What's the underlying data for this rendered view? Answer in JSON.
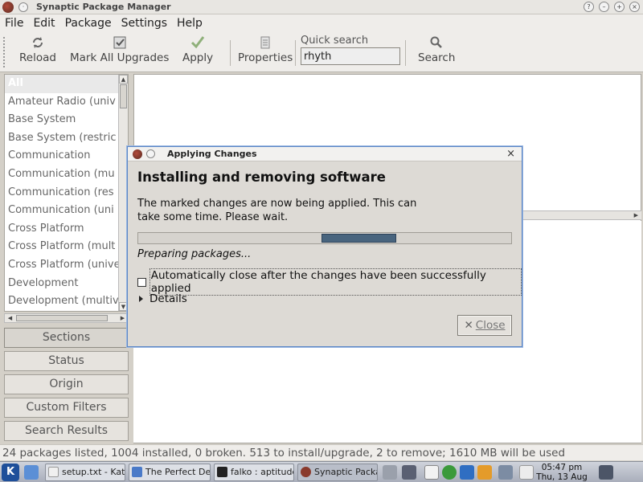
{
  "window": {
    "title": "Synaptic Package Manager"
  },
  "menu": [
    "File",
    "Edit",
    "Package",
    "Settings",
    "Help"
  ],
  "toolbar": {
    "reload": "Reload",
    "mark_all_upgrades": "Mark All Upgrades",
    "apply": "Apply",
    "properties": "Properties",
    "quick_search_label": "Quick search",
    "quick_search_value": "rhyth",
    "search": "Search"
  },
  "sections": {
    "items": [
      "All",
      "Amateur Radio (univ",
      "Base System",
      "Base System (restric",
      "Communication",
      "Communication (mu",
      "Communication (res",
      "Communication (uni",
      "Cross Platform",
      "Cross Platform (mult",
      "Cross Platform (unive",
      "Development",
      "Development (multiv"
    ]
  },
  "side_buttons": {
    "sections": "Sections",
    "status": "Status",
    "origin": "Origin",
    "custom_filters": "Custom Filters",
    "search_results": "Search Results"
  },
  "statusbar": {
    "text": "24 packages listed, 1004 installed, 0 broken. 513 to install/upgrade, 2 to remove; 1610 MB will be used"
  },
  "dialog": {
    "title": "Applying Changes",
    "heading": "Installing and removing software",
    "message": "The marked changes are now being applied. This can take some time. Please wait.",
    "progress_fraction": 0.2,
    "status": "Preparing packages...",
    "auto_close_label": "Automatically close after the changes have been successfully applied",
    "auto_close_checked": false,
    "details_label": "Details",
    "close_label": "Close"
  },
  "taskbar": {
    "tasks": [
      "setup.txt - Kate",
      "The Perfect Des",
      "falko : aptitude",
      "Synaptic Packag"
    ],
    "clock_time": "05:47 pm",
    "clock_date": "Thu, 13 Aug"
  }
}
